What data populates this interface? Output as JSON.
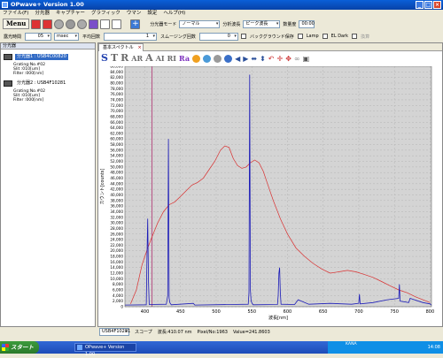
{
  "window": {
    "title": "OPwave+ Version 1.00"
  },
  "menu": [
    "ファイル(F)",
    "分光器",
    "キャプチャー",
    "グラフィック",
    "ウマン",
    "設定",
    "ヘルプ(H)"
  ],
  "toolbar": {
    "menu_label": "Menu",
    "mode_label": "分光器モード",
    "mode_value": "ノーマル",
    "wave_label": "分析波長",
    "wave_value": "ピーク波長",
    "count_label": "数量度",
    "count_value": "00:00"
  },
  "row2": {
    "exposure_label": "露光時間",
    "exposure_value": "05",
    "exposure_unit": "msec",
    "avg_label": "平均回数",
    "avg_value": "1",
    "smooth_label": "スムージング回数",
    "smooth_value": "0",
    "bg_label": "バックグラウンド保存",
    "lamp_label": "Lamp",
    "eldark_label": "EL Dark",
    "ref_label": "換算"
  },
  "left_pane": {
    "title": "分光器",
    "devices": [
      {
        "label": "分光器1 : USB4C00820",
        "grating": "Grating:No.#02",
        "slit": "Slit :010[um]",
        "filter": "Filter :000[nm]"
      },
      {
        "label": "分光器2 : USB4F10281",
        "grating": "Grating:No.#02",
        "slit": "Slit :010[um]",
        "filter": "Filter :000[nm]"
      }
    ]
  },
  "right_pane": {
    "tab_label": "基本スペクトル",
    "icon_letters": [
      "S",
      "T",
      "R",
      "AR",
      "A",
      "AI",
      "RI",
      "Ra"
    ]
  },
  "chart_data": {
    "type": "line",
    "xlabel": "波長[nm]",
    "ylabel": "カウント[counts]",
    "xlim": [
      372,
      802
    ],
    "ylim": [
      0,
      86000
    ],
    "x_ticks": [
      400,
      450,
      500,
      550,
      600,
      650,
      700,
      750,
      800
    ],
    "y_ticks": [
      0,
      2000,
      4000,
      6000,
      8000,
      10000,
      12000,
      14000,
      16000,
      18000,
      20000,
      22000,
      24000,
      26000,
      28000,
      30000,
      32000,
      34000,
      36000,
      38000,
      40000,
      42000,
      44000,
      46000,
      48000,
      50000,
      52000,
      54000,
      56000,
      58000,
      60000,
      62000,
      64000,
      66000,
      68000,
      70000,
      72000,
      74000,
      76000,
      78000,
      80000,
      82000,
      84000,
      86000
    ],
    "marker_x": 410.07,
    "series": [
      {
        "color": "#d93030",
        "x": [
          380,
          388,
          396,
          404,
          410,
          418,
          426,
          434,
          442,
          450,
          458,
          466,
          474,
          482,
          490,
          498,
          506,
          512,
          518,
          524,
          530,
          536,
          542,
          548,
          554,
          560,
          566,
          572,
          580,
          590,
          600,
          612,
          624,
          636,
          648,
          660,
          672,
          684,
          696,
          708,
          720,
          732,
          744,
          756,
          768,
          780,
          790,
          800
        ],
        "y": [
          1000,
          6000,
          15000,
          21000,
          25000,
          30000,
          34000,
          36500,
          37500,
          39500,
          41500,
          43500,
          44500,
          46000,
          49000,
          52000,
          56000,
          57500,
          57000,
          53000,
          50500,
          49500,
          50000,
          51500,
          52500,
          51500,
          48500,
          44000,
          38000,
          31500,
          26000,
          21000,
          18000,
          15500,
          13500,
          12000,
          12500,
          13000,
          12500,
          11500,
          10500,
          9000,
          7500,
          6000,
          5000,
          3500,
          2500,
          1500
        ]
      },
      {
        "color": "#1c1cb8",
        "x": [
          372,
          402,
          403,
          404,
          405,
          406,
          430,
          432,
          433,
          434,
          435,
          437,
          468,
          470,
          520,
          545,
          546,
          547,
          548,
          549,
          550,
          551,
          552,
          586,
          587,
          588,
          589,
          590,
          591,
          610,
          615,
          630,
          660,
          690,
          700,
          701,
          702,
          720,
          740,
          756,
          757,
          758,
          770,
          772,
          790,
          800,
          802
        ],
        "y": [
          600,
          700,
          18000,
          31500,
          9000,
          800,
          900,
          4000,
          60000,
          3000,
          1500,
          700,
          1200,
          600,
          800,
          900,
          5000,
          83000,
          6000,
          2000,
          1500,
          1000,
          700,
          800,
          4000,
          12000,
          14000,
          5000,
          900,
          800,
          2500,
          900,
          1200,
          900,
          1200,
          4500,
          1000,
          1500,
          2500,
          3000,
          8000,
          2000,
          1500,
          3000,
          1500,
          1000,
          500
        ]
      }
    ]
  },
  "status": {
    "device": "USB4F10281",
    "scope": "スコープ",
    "wavelength": "波長:410.07 nm",
    "pixel": "Pixel/No:1963",
    "value": "Value=241.8603"
  },
  "taskbar": {
    "start": "スタート",
    "item": "OPwave+ Version 1.00",
    "tray": "KANA",
    "clock": "14:08"
  }
}
